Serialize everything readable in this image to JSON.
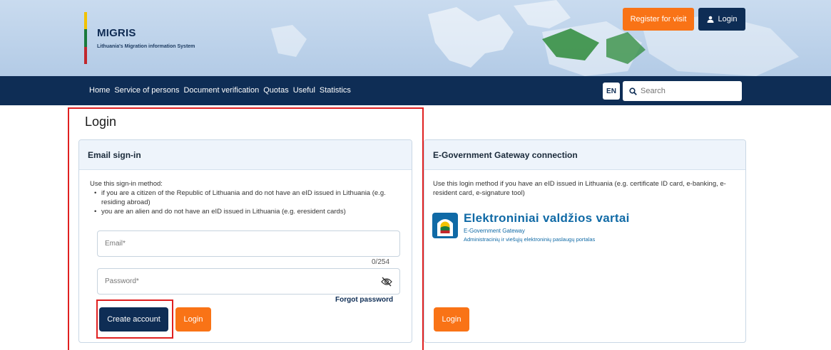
{
  "brand": {
    "title": "MIGRIS",
    "subtitle": "Lithuania's Migration information System",
    "flag_colors": [
      "#f2c200",
      "#1a7a3c",
      "#c1272d"
    ]
  },
  "header": {
    "register_label": "Register for visit",
    "login_label": "Login",
    "login_icon": "user-icon"
  },
  "nav": {
    "items": [
      "Home",
      "Service of persons",
      "Document verification",
      "Quotas",
      "Useful",
      "Statistics"
    ],
    "lang": "EN",
    "search_placeholder": "Search"
  },
  "page": {
    "title": "Login"
  },
  "email_signin": {
    "heading": "Email sign-in",
    "intro": "Use this sign-in method:",
    "bullets": [
      "if you are a citizen of the Republic of Lithuania and do not have an eID issued in Lithuania (e.g. residing abroad)",
      "you are an alien and do not have an eID issued in Lithuania (e.g. eresident cards)"
    ],
    "email_placeholder": "Email*",
    "email_counter": "0/254",
    "password_placeholder": "Password*",
    "forgot_label": "Forgot password",
    "create_account_label": "Create account",
    "login_label": "Login"
  },
  "egov": {
    "heading": "E-Government Gateway connection",
    "intro": "Use this login method if you have an eID issued in Lithuania (e.g. certificate ID card, e-banking, e-resident card, e-signature tool)",
    "logo_title": "Elektroniniai valdžios vartai",
    "logo_sub1": "E-Government Gateway",
    "logo_sub2": "Administracinių ir viešųjų elektroninių paslaugų portalas",
    "login_label": "Login"
  },
  "colors": {
    "navy": "#0e2d55",
    "orange": "#f97316",
    "highlight": "#e02020",
    "card_head": "#eef4fb"
  }
}
